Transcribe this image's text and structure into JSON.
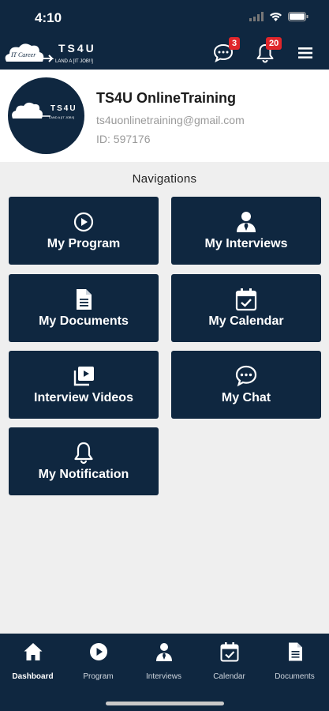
{
  "status": {
    "time": "4:10"
  },
  "header": {
    "logo_text": "TS4U",
    "logo_tagline": "LAND A [IT JOB!!]",
    "logo_script": "IT Career",
    "chat_badge": "3",
    "notif_badge": "20"
  },
  "profile": {
    "name": "TS4U OnlineTraining",
    "email": "ts4uonlinetraining@gmail.com",
    "id": "ID: 597176"
  },
  "navigation": {
    "title": "Navigations",
    "tiles": [
      {
        "label": "My Program",
        "icon": "play-circle-icon"
      },
      {
        "label": "My Interviews",
        "icon": "person-tie-icon"
      },
      {
        "label": "My Documents",
        "icon": "document-icon"
      },
      {
        "label": "My Calendar",
        "icon": "calendar-check-icon"
      },
      {
        "label": "Interview Videos",
        "icon": "video-library-icon"
      },
      {
        "label": "My Chat",
        "icon": "chat-bubble-icon"
      },
      {
        "label": "My Notification",
        "icon": "bell-icon"
      }
    ]
  },
  "tabbar": {
    "items": [
      {
        "label": "Dashboard",
        "icon": "home-icon",
        "active": true
      },
      {
        "label": "Program",
        "icon": "play-circle-icon"
      },
      {
        "label": "Interviews",
        "icon": "person-tie-icon"
      },
      {
        "label": "Calendar",
        "icon": "calendar-check-icon"
      },
      {
        "label": "Documents",
        "icon": "document-icon"
      }
    ]
  },
  "colors": {
    "primary": "#0f2740",
    "badge": "#e0262b",
    "background": "#efefef"
  }
}
